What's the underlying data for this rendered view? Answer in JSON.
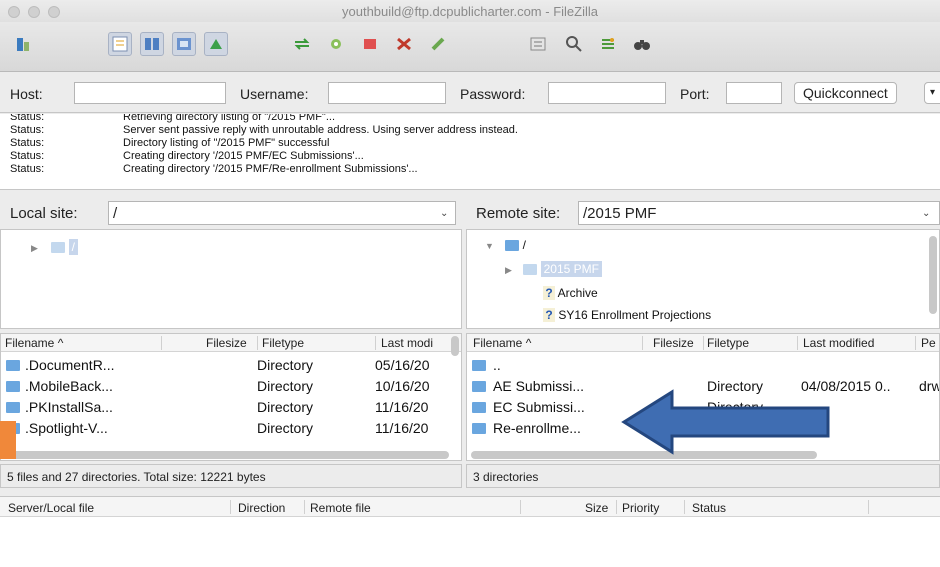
{
  "window": {
    "title": "youthbuild@ftp.dcpublicharter.com - FileZilla"
  },
  "toolbar": {
    "icons": [
      "site-manager-icon",
      "toggle-message-log-icon",
      "toggle-tree-icon",
      "toggle-remote-tree-icon",
      "toggle-queue-icon",
      "refresh-icon",
      "process-queue-icon",
      "cancel-icon",
      "disconnect-icon",
      "reconnect-icon",
      "filter-icon",
      "compare-icon",
      "sync-browse-icon",
      "search-icon"
    ]
  },
  "quickconnect": {
    "host_label": "Host:",
    "host_value": "",
    "username_label": "Username:",
    "username_value": "",
    "password_label": "Password:",
    "password_value": "",
    "port_label": "Port:",
    "port_value": "",
    "button_label": "Quickconnect",
    "dropdown_glyph": "▾"
  },
  "log": [
    {
      "label": "Status:",
      "message": "Retrieving directory listing of \"/2015 PMF\"..."
    },
    {
      "label": "Status:",
      "message": "Server sent passive reply with unroutable address. Using server address instead."
    },
    {
      "label": "Status:",
      "message": "Directory listing of \"/2015 PMF\" successful"
    },
    {
      "label": "Status:",
      "message": "Creating directory '/2015 PMF/EC Submissions'..."
    },
    {
      "label": "Status:",
      "message": "Creating directory '/2015 PMF/Re-enrollment Submissions'..."
    }
  ],
  "local": {
    "site_label": "Local site:",
    "site_path": "/",
    "tree": [
      {
        "label": "/"
      }
    ],
    "columns": {
      "filename": "Filename ^",
      "filesize": "Filesize",
      "filetype": "Filetype",
      "modified": "Last modi"
    },
    "files": [
      {
        "name": ".DocumentR...",
        "type": "Directory",
        "modified": "05/16/20"
      },
      {
        "name": ".MobileBack...",
        "type": "Directory",
        "modified": "10/16/20"
      },
      {
        "name": ".PKInstallSa...",
        "type": "Directory",
        "modified": "11/16/20"
      },
      {
        "name": ".Spotlight-V...",
        "type": "Directory",
        "modified": "11/16/20"
      }
    ],
    "status": "5 files and 27 directories. Total size: 12221 bytes"
  },
  "remote": {
    "site_label": "Remote site:",
    "site_path": "/2015 PMF",
    "tree": [
      {
        "label": "/"
      },
      {
        "label": "2015 PMF"
      },
      {
        "label": "Archive"
      },
      {
        "label": "SY16 Enrollment Projections"
      }
    ],
    "columns": {
      "filename": "Filename ^",
      "filesize": "Filesize",
      "filetype": "Filetype",
      "modified": "Last modified",
      "perms": "Pe"
    },
    "files": [
      {
        "name": "..",
        "type": "",
        "modified": "",
        "perms": ""
      },
      {
        "name": "AE Submissi...",
        "type": "Directory",
        "modified": "04/08/2015 0..",
        "perms": "drw"
      },
      {
        "name": "EC Submissi...",
        "type": "Directory",
        "modified": "",
        "perms": ""
      },
      {
        "name": "Re-enrollme...",
        "type": "Directory",
        "modified": "",
        "perms": ""
      }
    ],
    "status": "3 directories"
  },
  "queue": {
    "columns": {
      "server_local": "Server/Local file",
      "direction": "Direction",
      "remote": "Remote file",
      "size": "Size",
      "priority": "Priority",
      "status": "Status"
    }
  },
  "colors": {
    "arrow_fill": "#3f6db2",
    "arrow_stroke": "#24477f",
    "marker": "#f0883a",
    "folder": "#6aa6df"
  }
}
